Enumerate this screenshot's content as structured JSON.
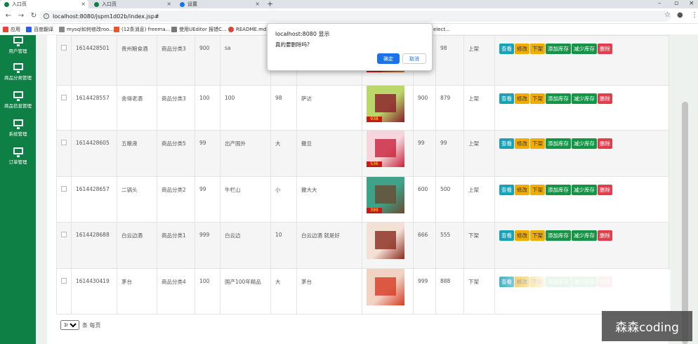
{
  "browser": {
    "tabs": [
      {
        "label": "入口页"
      },
      {
        "label": "入口页"
      },
      {
        "label": "设置"
      }
    ],
    "url": "localhost:8080/jspm1d02b/index.jsp#",
    "bookmarks": [
      "应用",
      "百度翻译",
      "mysql如何修改roo...",
      "(12条消息) freema...",
      "使用UEditor 报错C...",
      "README.md -",
      "elect..."
    ]
  },
  "sidebar": {
    "items": [
      {
        "label": "用户管理"
      },
      {
        "label": "商品分类管理"
      },
      {
        "label": "商品信息管理"
      },
      {
        "label": "系统管理"
      },
      {
        "label": "订单管理"
      }
    ]
  },
  "dialog": {
    "title": "localhost:8080 显示",
    "message": "真的要删除吗?",
    "ok": "确定",
    "cancel": "取消"
  },
  "actions": {
    "view": "查看",
    "edit": "修改",
    "down": "下架",
    "add_stock": "添加库存",
    "reduce_stock": "减少库存",
    "delete": "删除"
  },
  "rows": [
    {
      "id": "1614428501",
      "name": "贵州粮食酒",
      "category": "商品分类3",
      "price": "900",
      "origin": "sa",
      "spec": "",
      "desc": "",
      "price2": "",
      "stock": "98",
      "status": "上架",
      "img_colors": [
        "#7a3b14",
        "#c9782e"
      ],
      "img_tag": "118"
    },
    {
      "id": "1614428557",
      "name": "舍得老酒",
      "category": "商品分类3",
      "price": "100",
      "origin": "100",
      "spec": "98",
      "desc": "萨达",
      "price2": "900",
      "stock": "879",
      "status": "上架",
      "img_colors": [
        "#b9d76a",
        "#8b1a2b"
      ],
      "img_tag": "938"
    },
    {
      "id": "1614428605",
      "name": "五粮液",
      "category": "商品分类5",
      "price": "99",
      "origin": "出产国外",
      "spec": "大",
      "desc": "撒旦",
      "price2": "99",
      "stock": "99",
      "status": "上架",
      "img_colors": [
        "#f4d6dc",
        "#c8223a"
      ],
      "img_tag": "536"
    },
    {
      "id": "1614428657",
      "name": "二锅头",
      "category": "商品分类2",
      "price": "99",
      "origin": "牛栏山",
      "spec": "小",
      "desc": "撒大大",
      "price2": "600",
      "stock": "500",
      "status": "上架",
      "img_colors": [
        "#3fa187",
        "#6b4a32"
      ],
      "img_tag": "399"
    },
    {
      "id": "1614428688",
      "name": "白云边酒",
      "category": "商品分类1",
      "price": "999",
      "origin": "白云边",
      "spec": "10",
      "desc": "白云边酒 就是好",
      "price2": "666",
      "stock": "555",
      "status": "下架",
      "img_colors": [
        "#f3e1d6",
        "#8a2a1d"
      ],
      "img_tag": ""
    },
    {
      "id": "1614430419",
      "name": "茅台",
      "category": "商品分类4",
      "price": "100",
      "origin": "国产100年精品",
      "spec": "大",
      "desc": "茅台",
      "price2": "999",
      "stock": "888",
      "status": "下架",
      "img_colors": [
        "#f1d2c3",
        "#d63b22"
      ],
      "img_tag": ""
    }
  ],
  "pager": {
    "page_size": "10",
    "suffix": "条 每页"
  },
  "watermark": "森森coding"
}
